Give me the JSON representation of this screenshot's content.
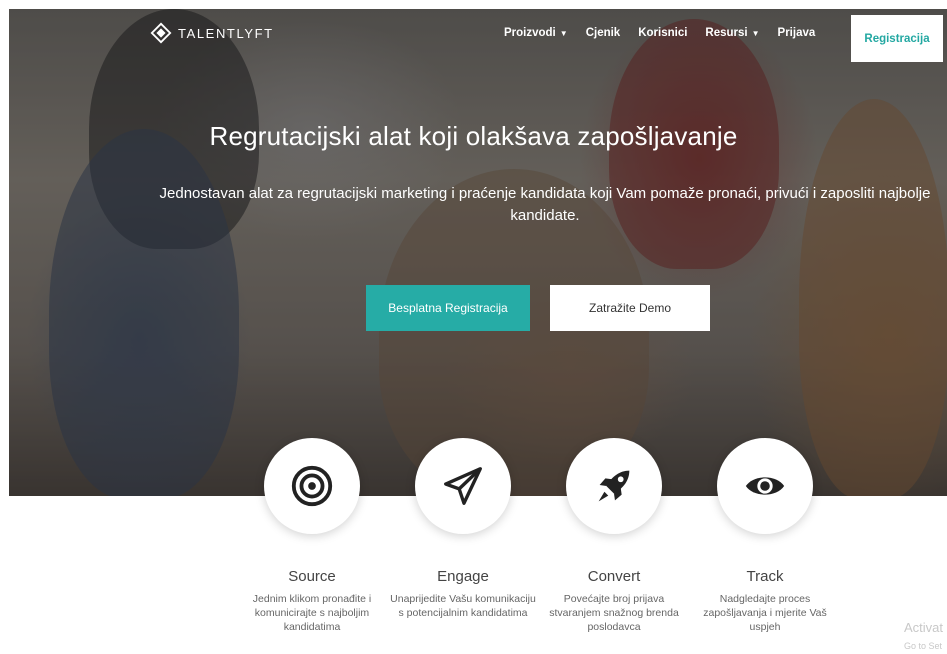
{
  "brand": {
    "name": "TalentLyft",
    "logo_text": "TALENTLYFT"
  },
  "nav": {
    "items": [
      {
        "label": "Proizvodi",
        "dropdown": true
      },
      {
        "label": "Cjenik",
        "dropdown": false
      },
      {
        "label": "Korisnici",
        "dropdown": false
      },
      {
        "label": "Resursi",
        "dropdown": true
      },
      {
        "label": "Prijava",
        "dropdown": false
      }
    ],
    "register_label": "Registracija"
  },
  "hero": {
    "title": "Regrutacijski alat koji olakšava zapošljavanje",
    "subtitle": "Jednostavan alat za regrutacijski marketing i praćenje kandidata koji Vam pomaže pronaći, privući i zaposliti najbolje kandidate.",
    "cta_primary": "Besplatna Registracija",
    "cta_secondary": "Zatražite Demo"
  },
  "features": [
    {
      "icon": "target-icon",
      "title": "Source",
      "desc": "Jednim klikom pronađite i komunicirajte s najboljim kandidatima"
    },
    {
      "icon": "paper-plane-icon",
      "title": "Engage",
      "desc": "Unaprijedite Vašu komunikaciju s potencijalnim kandidatima"
    },
    {
      "icon": "rocket-icon",
      "title": "Convert",
      "desc": "Povećajte broj prijava stvaranjem snažnog brenda poslodavca"
    },
    {
      "icon": "eye-icon",
      "title": "Track",
      "desc": "Nadgledajte proces zapošljavanja i mjerite Vaš uspjeh"
    }
  ],
  "watermark": {
    "line1": "Activat",
    "line2": "Go to Set"
  },
  "colors": {
    "accent": "#26aca6",
    "text": "#444444",
    "muted": "#666666"
  }
}
